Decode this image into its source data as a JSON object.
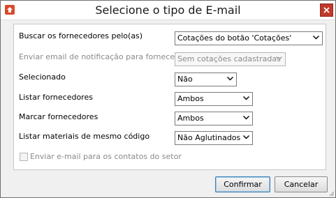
{
  "window": {
    "title": "Selecione o tipo de E-mail"
  },
  "fields": [
    {
      "label": "Buscar os fornecedores pelo(as)",
      "value": "Cotações do botão 'Cotações'",
      "enabled": true
    },
    {
      "label": "Enviar email de notificação para fornecedores",
      "value": "Sem cotações cadastradas",
      "enabled": false
    },
    {
      "label": "Selecionado",
      "value": "Não",
      "enabled": true
    },
    {
      "label": "Listar fornecedores",
      "value": "Ambos",
      "enabled": true
    },
    {
      "label": "Marcar fornecedores",
      "value": "Ambos",
      "enabled": true
    },
    {
      "label": "Listar materiais de mesmo código",
      "value": "Não Aglutinados",
      "enabled": true
    }
  ],
  "checkbox": {
    "label": "Enviar e-mail para os contatos do setor",
    "checked": false,
    "enabled": false
  },
  "buttons": {
    "confirm": "Confirmar",
    "cancel": "Cancelar"
  },
  "colors": {
    "close": "#c0392b",
    "app_icon": "#d94a2b",
    "panel": "#ffffff",
    "background": "#f0f0f0"
  }
}
